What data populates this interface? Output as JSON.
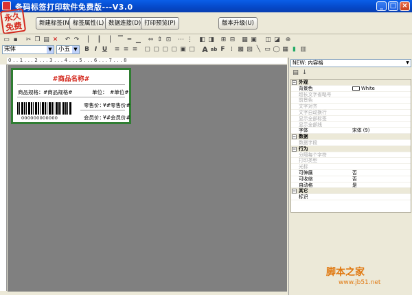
{
  "window": {
    "title": "条码标签打印软件免费版---V3.0"
  },
  "stamp": {
    "text": "永久免费"
  },
  "menubar": {
    "buttons": [
      "新建标签(N)",
      "标签属性(L)",
      "数据连接(D)",
      "打印预览(P)",
      "版本升级(U)"
    ]
  },
  "toolbar": {
    "font_value": "宋体",
    "size_value": "小五",
    "bold": "B",
    "italic": "I",
    "underline": "U"
  },
  "ruler": {
    "labels": "0 . . 1 . . . 2 . . . 3 . . . 4 . . . 5 . . . 6 . . . 7 . . . 8"
  },
  "label": {
    "title": "#商品名称#",
    "spec_label": "商品规格：",
    "spec_value": "#商品规格#",
    "unit_label": "单位：",
    "unit_value": "#单位#",
    "retail_label": "零售价：",
    "retail_value": "¥#零售价#",
    "member_label": "会员价：",
    "member_value": "¥#会员价#",
    "barcode_number": "000000000000"
  },
  "panel": {
    "object_select": "NEW: 内容格",
    "properties": [
      {
        "type": "cat",
        "name": "外观"
      },
      {
        "type": "row",
        "name": "背景色",
        "value": "White",
        "swatch": true
      },
      {
        "type": "dis",
        "name": "超长文字省略号"
      },
      {
        "type": "dis",
        "name": "前景色"
      },
      {
        "type": "dis",
        "name": "文字对齐"
      },
      {
        "type": "dis",
        "name": "文字自动换行"
      },
      {
        "type": "dis",
        "name": "显示全部标签"
      },
      {
        "type": "dis",
        "name": "显示全部线"
      },
      {
        "type": "row",
        "name": "字体",
        "value": "宋体 (9)"
      },
      {
        "type": "cat",
        "name": "数据"
      },
      {
        "type": "dis",
        "name": "数据字段"
      },
      {
        "type": "cat",
        "name": "行为"
      },
      {
        "type": "dis",
        "name": "分隔每个字符"
      },
      {
        "type": "dis",
        "name": "打印类型"
      },
      {
        "type": "dis",
        "name": "光标"
      },
      {
        "type": "row",
        "name": "可伸展",
        "value": "否"
      },
      {
        "type": "row",
        "name": "可收缩",
        "value": "否"
      },
      {
        "type": "row",
        "name": "自动格",
        "value": "是"
      },
      {
        "type": "cat",
        "name": "其它"
      },
      {
        "type": "row",
        "name": "标识",
        "value": ""
      }
    ]
  },
  "watermark": {
    "text": "脚本之家",
    "url": "www.jb51.net"
  }
}
